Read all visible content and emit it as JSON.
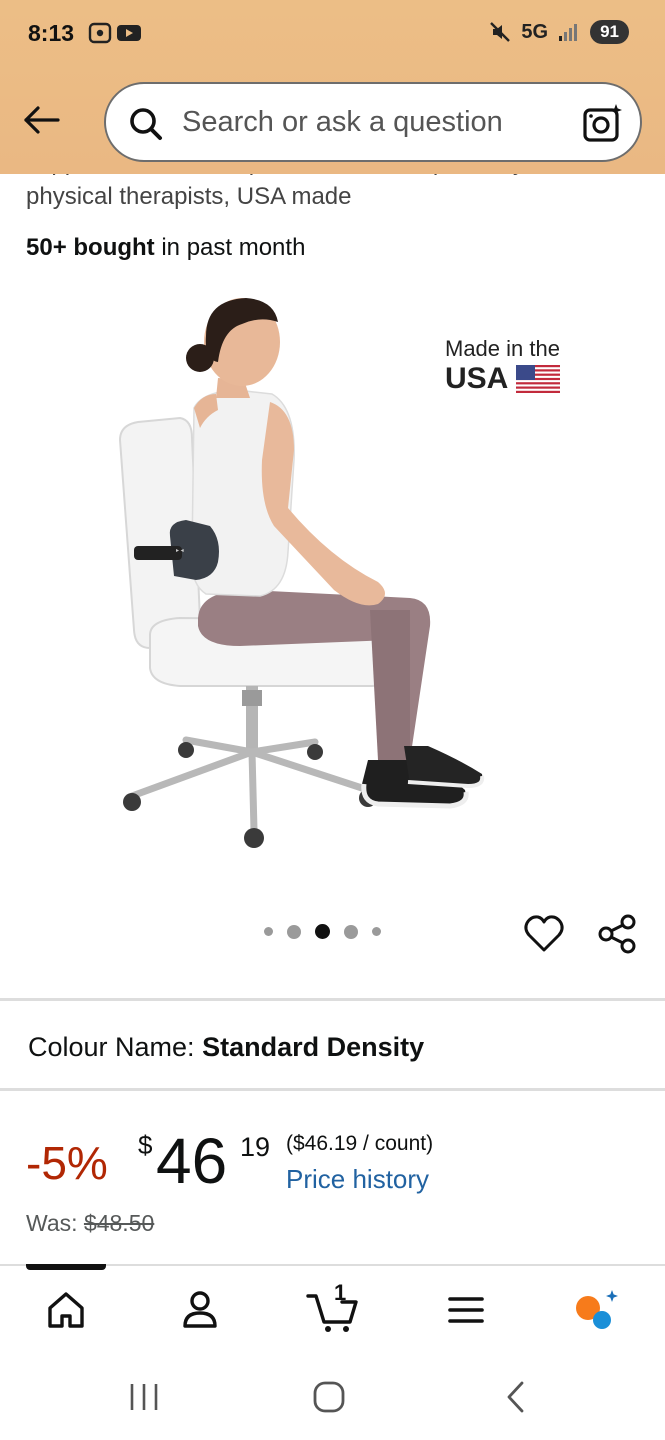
{
  "status_bar": {
    "time": "8:13",
    "network": "5G",
    "battery": "91"
  },
  "search": {
    "placeholder": "Search or ask a question"
  },
  "product": {
    "subtitle_partial": "support cushion, the preferred lumbar pillow by",
    "subtitle_rest": "physical therapists, USA made",
    "bought_bold": "50+ bought",
    "bought_rest": " in past month",
    "badge_line1": "Made in the",
    "badge_line2": "USA",
    "image_count": 5,
    "active_image_index": 2
  },
  "colour": {
    "label": "Colour Name: ",
    "value": "Standard Density"
  },
  "price": {
    "discount": "-5%",
    "currency": "$",
    "whole": "46",
    "fraction": "19",
    "unit_price": "($46.19 / count)",
    "price_history": "Price history",
    "was_label": "Was: ",
    "was_value": "$48.50"
  },
  "bottom_nav": {
    "items": [
      "home-icon",
      "account-icon",
      "cart-icon",
      "menu-icon",
      "rufus-icon"
    ],
    "cart_count": "1"
  },
  "colors": {
    "header": "#ecbe86",
    "discount": "#b12704",
    "link": "#2162a1"
  }
}
